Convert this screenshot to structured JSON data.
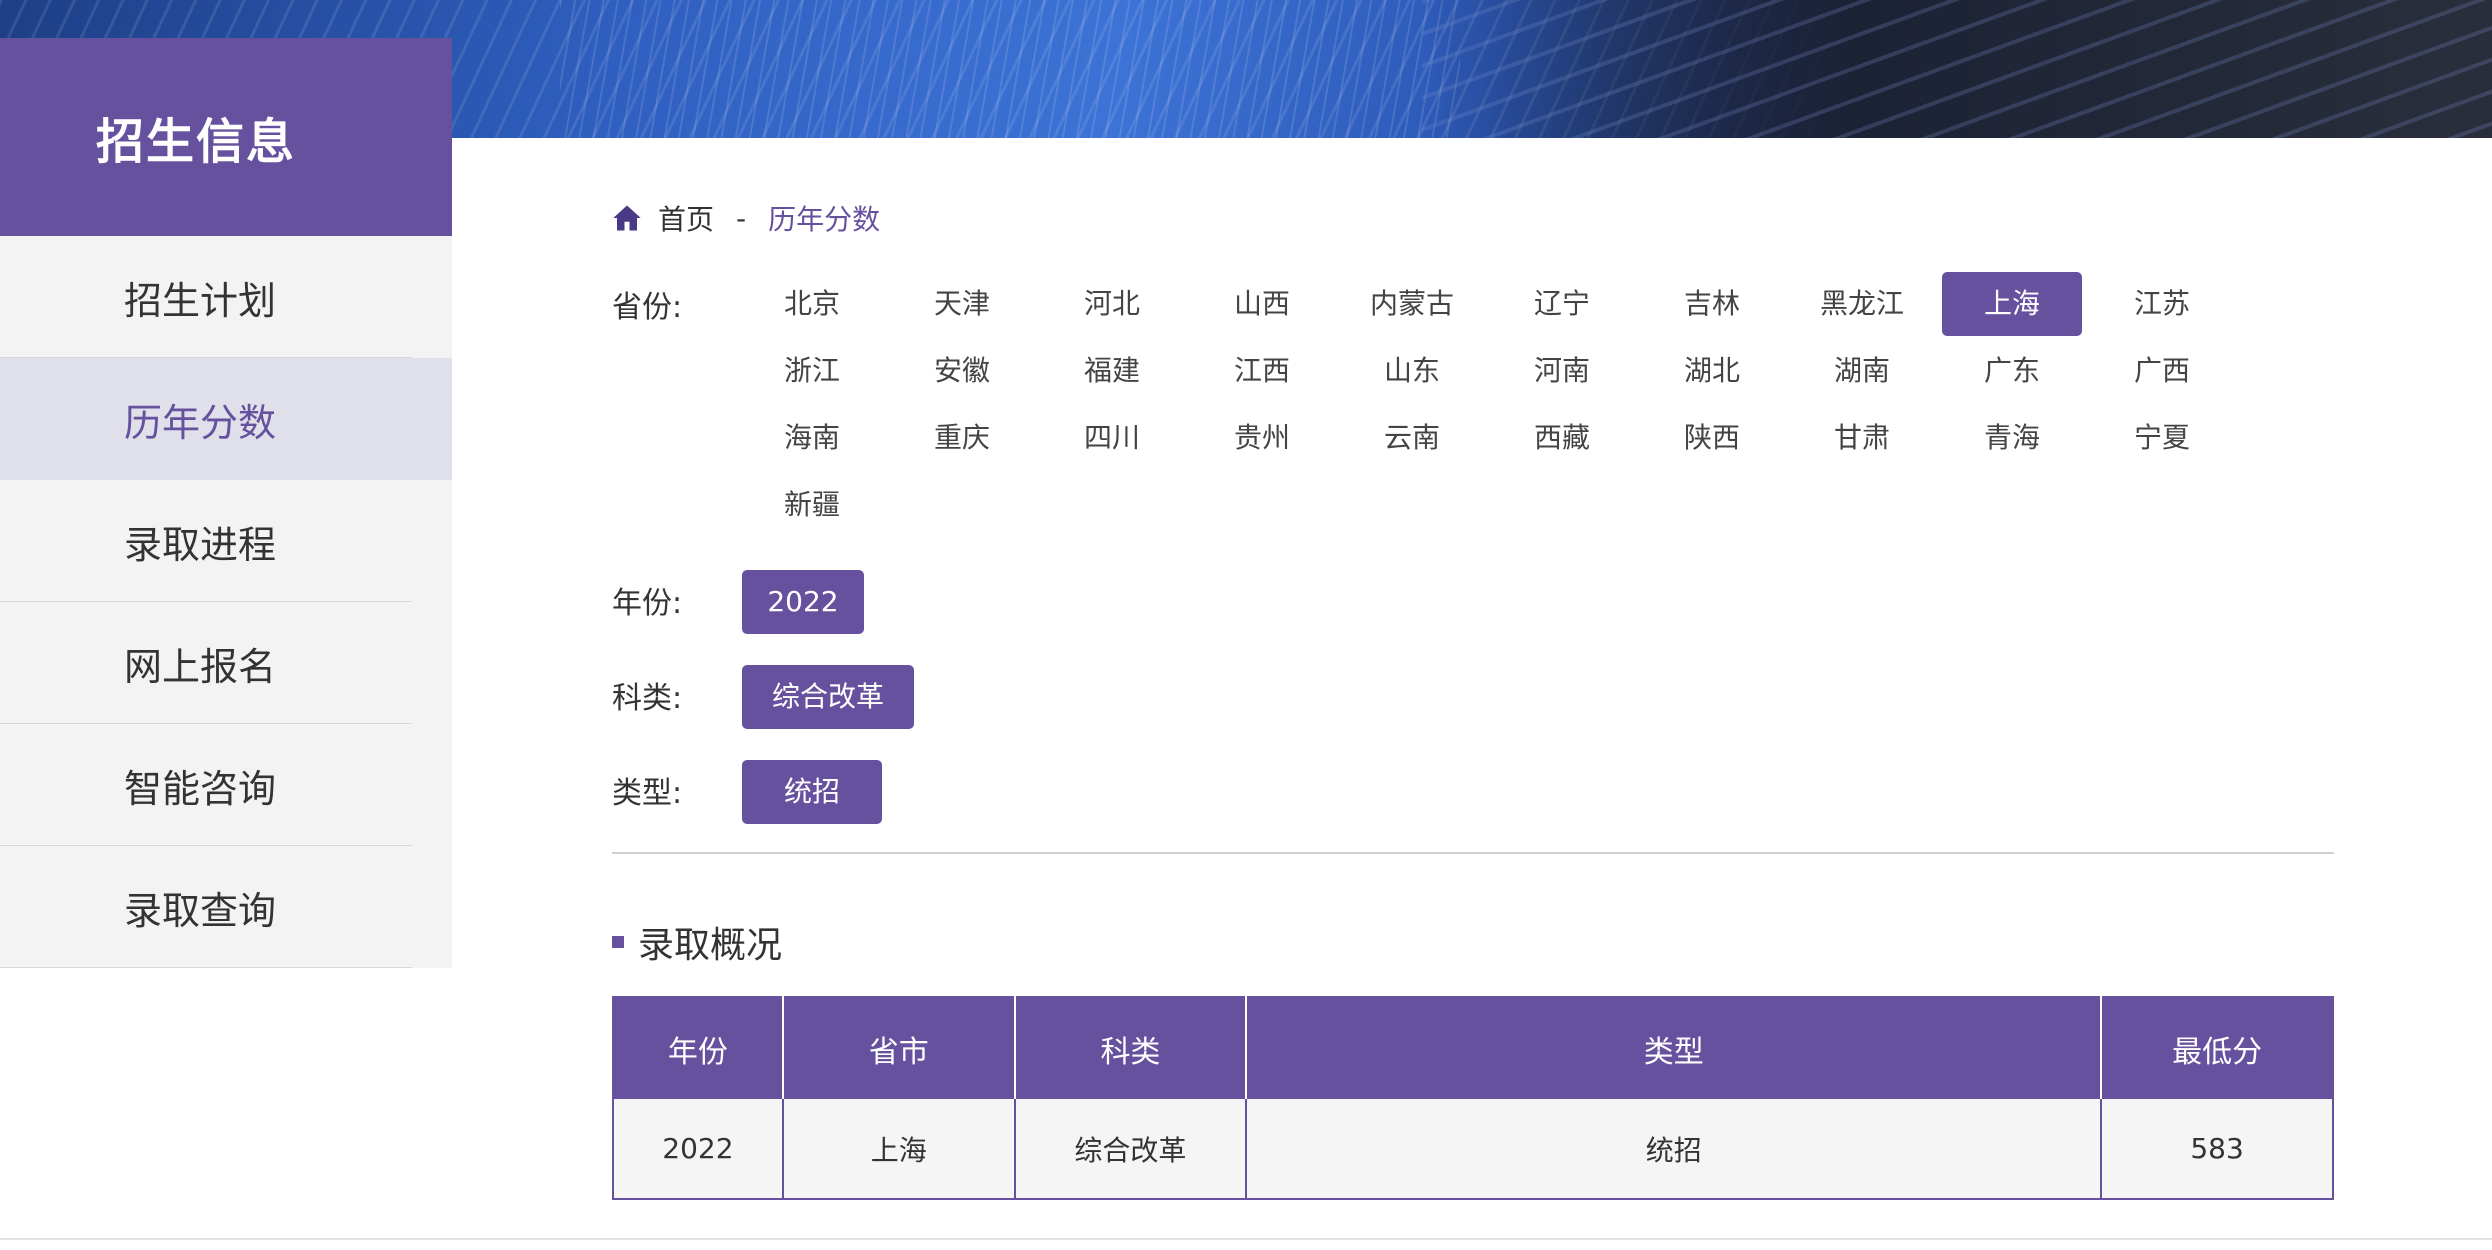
{
  "sidebar": {
    "title": "招生信息",
    "items": [
      {
        "label": "招生计划",
        "active": false
      },
      {
        "label": "历年分数",
        "active": true
      },
      {
        "label": "录取进程",
        "active": false
      },
      {
        "label": "网上报名",
        "active": false
      },
      {
        "label": "智能咨询",
        "active": false
      },
      {
        "label": "录取查询",
        "active": false
      }
    ]
  },
  "breadcrumb": {
    "home": "首页",
    "separator": "-",
    "current": "历年分数"
  },
  "filters": {
    "province_label": "省份:",
    "provinces": [
      "北京",
      "天津",
      "河北",
      "山西",
      "内蒙古",
      "辽宁",
      "吉林",
      "黑龙江",
      "上海",
      "江苏",
      "浙江",
      "安徽",
      "福建",
      "江西",
      "山东",
      "河南",
      "湖北",
      "湖南",
      "广东",
      "广西",
      "海南",
      "重庆",
      "四川",
      "贵州",
      "云南",
      "西藏",
      "陕西",
      "甘肃",
      "青海",
      "宁夏",
      "新疆"
    ],
    "selected_province": "上海",
    "year_label": "年份:",
    "year_value": "2022",
    "category_label": "科类:",
    "category_value": "综合改革",
    "type_label": "类型:",
    "type_value": "统招"
  },
  "section": {
    "title": "录取概况"
  },
  "table": {
    "headers": [
      "年份",
      "省市",
      "科类",
      "类型",
      "最低分"
    ],
    "rows": [
      [
        "2022",
        "上海",
        "综合改革",
        "统招",
        "583"
      ]
    ]
  },
  "colors": {
    "accent": "#66519f",
    "active_bg": "#e0e0ea",
    "sidebar_bg": "#f3f3f3"
  }
}
